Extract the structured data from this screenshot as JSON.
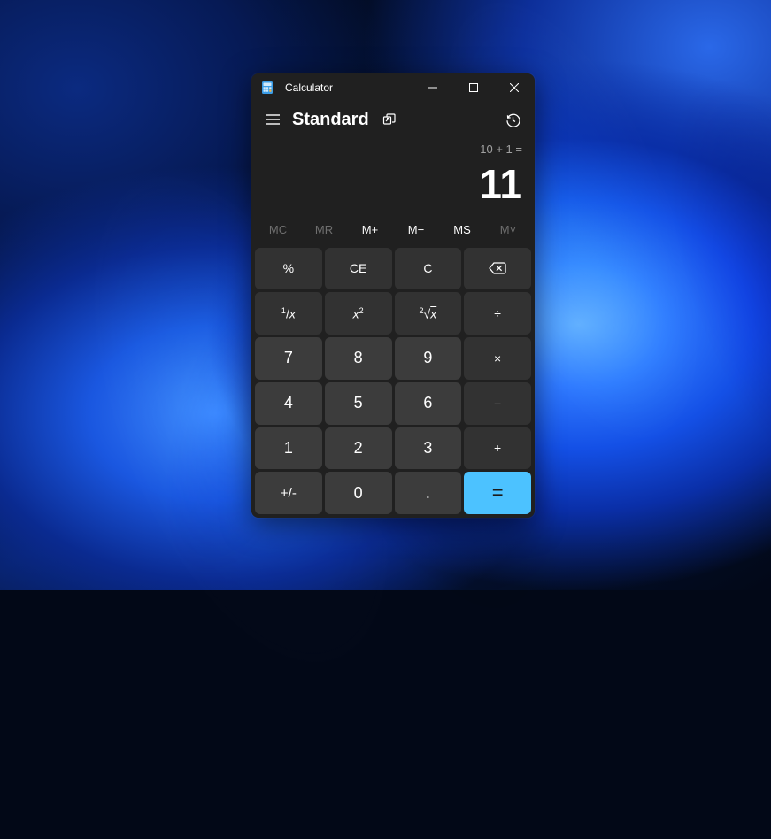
{
  "window": {
    "title": "Calculator"
  },
  "mode": {
    "label": "Standard"
  },
  "display": {
    "expression": "10 + 1 =",
    "result": "11"
  },
  "memory": {
    "mc": "MC",
    "mr": "MR",
    "mplus": "M+",
    "mminus": "M−",
    "ms": "MS",
    "mlist": "M˅"
  },
  "keys": {
    "percent": "%",
    "ce": "CE",
    "c": "C",
    "recip_pre": "1",
    "recip_x": "x",
    "sqr_x": "x",
    "sqr_exp": "2",
    "sqrt_exp": "2",
    "sqrt_x": "x",
    "divide": "÷",
    "d7": "7",
    "d8": "8",
    "d9": "9",
    "multiply": "×",
    "d4": "4",
    "d5": "5",
    "d6": "6",
    "minus": "−",
    "d1": "1",
    "d2": "2",
    "d3": "3",
    "plus": "+",
    "negate": "+/-",
    "d0": "0",
    "decimal": ".",
    "equals": "="
  }
}
